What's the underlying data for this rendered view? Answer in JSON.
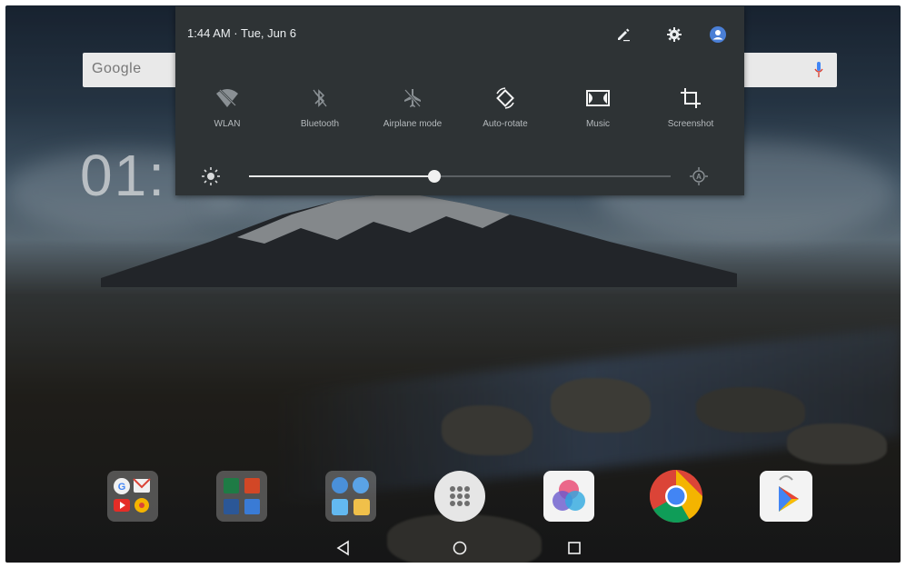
{
  "status": {
    "time_date": "1:44 AM · Tue, Jun 6"
  },
  "search": {
    "logo_text": "Google"
  },
  "home_clock": {
    "partial_text": "01:"
  },
  "quick_settings": {
    "tiles": [
      {
        "label": "WLAN",
        "icon": "wifi-off-icon"
      },
      {
        "label": "Bluetooth",
        "icon": "bluetooth-off-icon"
      },
      {
        "label": "Airplane mode",
        "icon": "airplane-icon"
      },
      {
        "label": "Auto-rotate",
        "icon": "auto-rotate-icon"
      },
      {
        "label": "Music",
        "icon": "dolby-music-icon"
      },
      {
        "label": "Screenshot",
        "icon": "crop-screenshot-icon"
      }
    ],
    "brightness_level": 0.44,
    "top_icons": [
      "edit-icon",
      "settings-gear-icon",
      "user-account-icon"
    ]
  },
  "dock": {
    "apps": [
      "google-apps-folder",
      "office-folder",
      "lenovo-folder",
      "app-drawer",
      "photo-app",
      "chrome",
      "play-store"
    ]
  },
  "colors": {
    "panel": "#2e3335",
    "accent": "#4285f4",
    "text": "#eceff1"
  }
}
